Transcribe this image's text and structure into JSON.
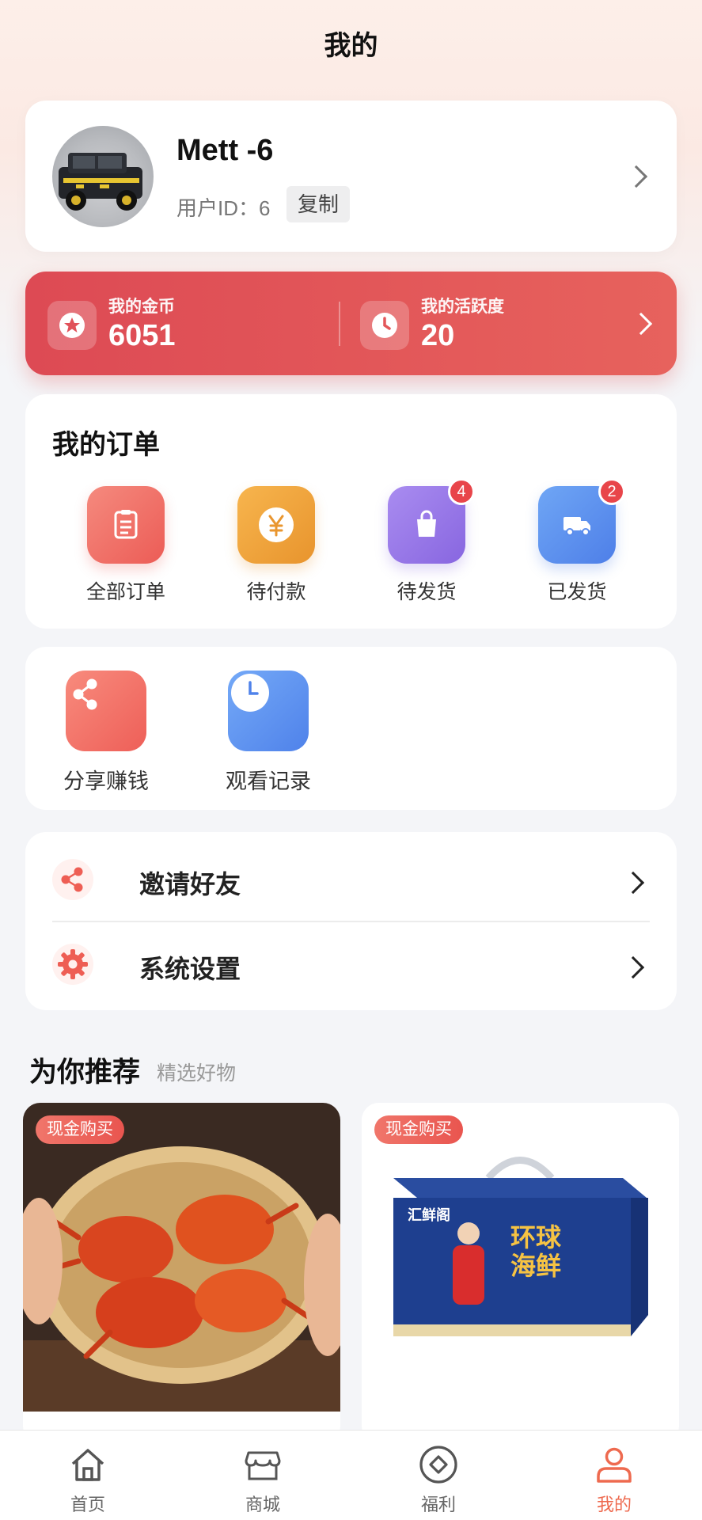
{
  "header": {
    "title": "我的"
  },
  "profile": {
    "nickname": "Mett -6",
    "uid_label": "用户ID：6",
    "copy_label": "复制"
  },
  "coins": {
    "gold_label": "我的金币",
    "gold_value": "6051",
    "activity_label": "我的活跃度",
    "activity_value": "20"
  },
  "orders": {
    "title": "我的订单",
    "items": [
      {
        "label": "全部订单",
        "icon": "clipboard-icon",
        "badge": ""
      },
      {
        "label": "待付款",
        "icon": "yen-icon",
        "badge": ""
      },
      {
        "label": "待发货",
        "icon": "bag-icon",
        "badge": "4"
      },
      {
        "label": "已发货",
        "icon": "truck-icon",
        "badge": "2"
      }
    ]
  },
  "tools": [
    {
      "label": "分享赚钱",
      "icon": "share-icon"
    },
    {
      "label": "观看记录",
      "icon": "clock-icon"
    }
  ],
  "menu": [
    {
      "label": "邀请好友",
      "icon": "share-icon"
    },
    {
      "label": "系统设置",
      "icon": "gear-icon"
    }
  ],
  "recommend": {
    "title": "为你推荐",
    "subtitle": "精选好物",
    "products": [
      {
        "tag": "现金购买",
        "image": "steamed-crabs"
      },
      {
        "tag": "现金购买",
        "image": "seafood-gift-box",
        "box_brand": "汇鲜阁",
        "box_slogan": "环球海鲜"
      }
    ]
  },
  "tabbar": [
    {
      "label": "首页",
      "icon": "home-icon",
      "active": false
    },
    {
      "label": "商城",
      "icon": "store-icon",
      "active": false
    },
    {
      "label": "福利",
      "icon": "diamond-coin-icon",
      "active": false
    },
    {
      "label": "我的",
      "icon": "user-icon",
      "active": true
    }
  ],
  "colors": {
    "accent": "#e8554f",
    "tab_active": "#ee6a4f",
    "coin_bar_start": "#dd4a54",
    "coin_bar_end": "#e7625d"
  }
}
